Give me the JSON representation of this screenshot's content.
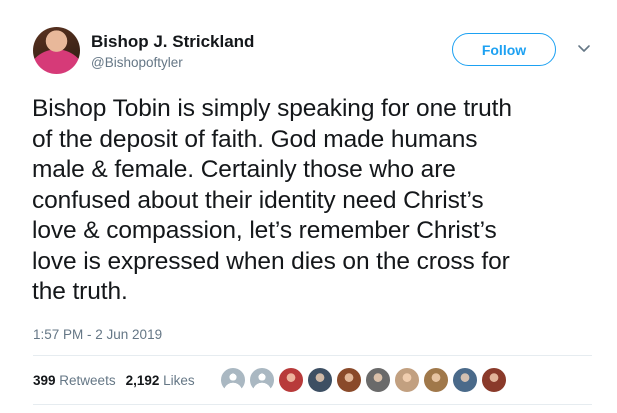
{
  "tweet": {
    "author_name": "Bishop J. Strickland",
    "author_handle": "@Bishopoftyler",
    "follow_label": "Follow",
    "text": "Bishop Tobin is simply speaking for one truth\nof the deposit of faith.  God made humans\nmale & female.  Certainly those who are\nconfused about their identity need Christ’s\nlove & compassion, let’s remember Christ’s\nlove is expressed when dies on the cross for\nthe truth.",
    "timestamp": "1:57 PM - 2 Jun 2019"
  },
  "stats": {
    "retweets_count": "399",
    "retweets_label": "Retweets",
    "likes_count": "2,192",
    "likes_label": "Likes"
  },
  "colors": {
    "accent": "#1da1f2",
    "secondary_text": "#657786",
    "divider": "#e6ecf0"
  },
  "liker_avatars": [
    {
      "color": "#aab8c2",
      "icon": "default-avatar-icon"
    },
    {
      "color": "#aab8c2",
      "icon": "default-avatar-icon"
    },
    {
      "color": "#b83a3a"
    },
    {
      "color": "#3d4f63"
    },
    {
      "color": "#8a4a2a"
    },
    {
      "color": "#6a6a6a"
    },
    {
      "color": "#c2a080"
    },
    {
      "color": "#a0784a"
    },
    {
      "color": "#4a6a8a"
    },
    {
      "color": "#8a3a2a"
    }
  ]
}
